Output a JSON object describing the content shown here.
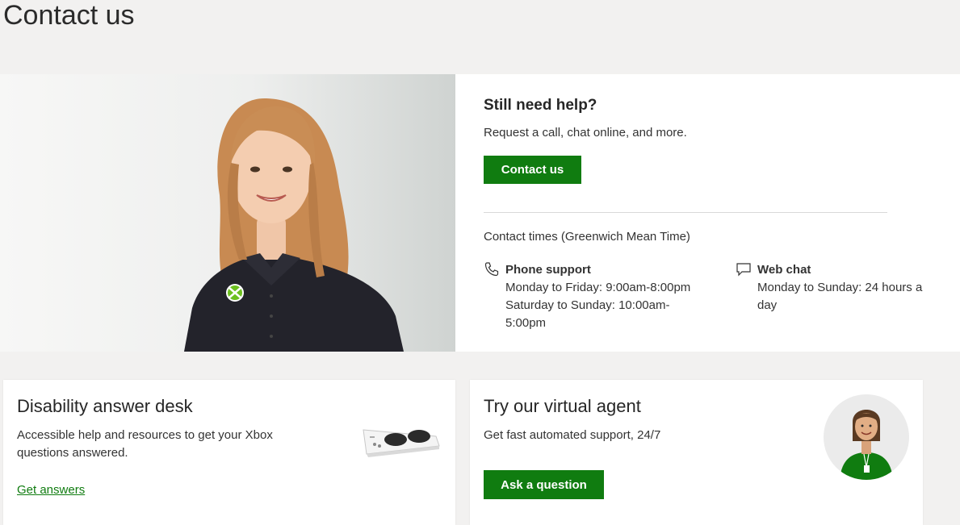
{
  "page": {
    "title": "Contact us"
  },
  "help": {
    "heading": "Still need help?",
    "description": "Request a call, chat online, and more.",
    "contact_button": "Contact us",
    "times_heading": "Contact times (Greenwich Mean Time)",
    "phone": {
      "icon": "phone-icon",
      "title": "Phone support",
      "line1": "Monday to Friday: 9:00am-8:00pm",
      "line2": "Saturday to Sunday: 10:00am-",
      "line3": "5:00pm"
    },
    "webchat": {
      "icon": "chat-icon",
      "title": "Web chat",
      "line1": "Monday to Sunday: 24 hours a",
      "line2": "day"
    }
  },
  "cards": {
    "disability": {
      "title": "Disability answer desk",
      "description": "Accessible help and resources to get your Xbox questions answered.",
      "link": "Get answers"
    },
    "virtual_agent": {
      "title": "Try our virtual agent",
      "description": "Get fast automated support, 24/7",
      "button": "Ask a question"
    }
  },
  "colors": {
    "accent": "#107c10",
    "background": "#f2f1f0"
  }
}
